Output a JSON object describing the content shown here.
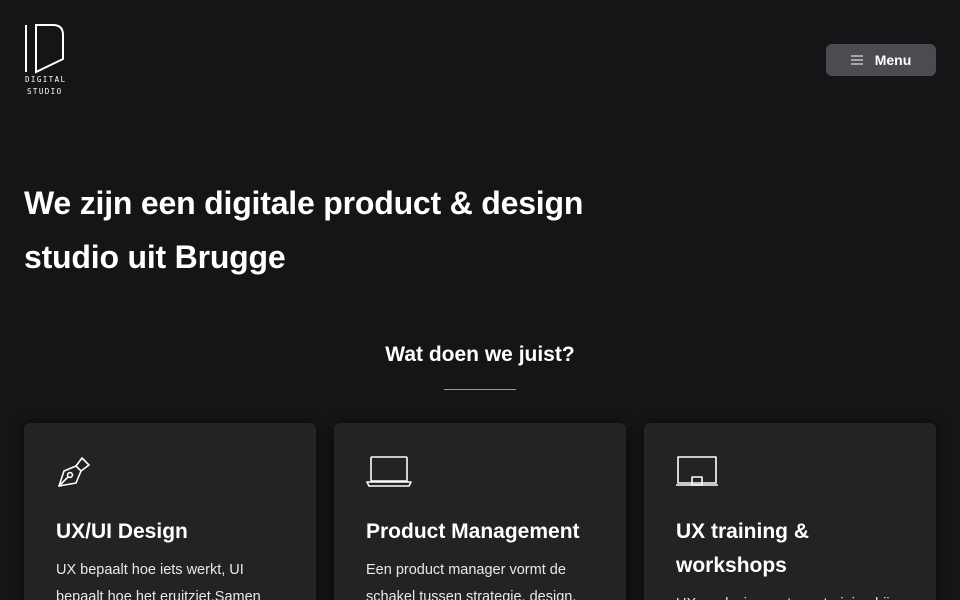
{
  "header": {
    "logo": {
      "line1": "DIGITAL",
      "line2": "STUDIO"
    },
    "menu_label": "Menu"
  },
  "hero": {
    "title": "We zijn een digitale product & design studio uit Brugge"
  },
  "services_section": {
    "title": "Wat doen we juist?",
    "cards": [
      {
        "icon": "pen-nib-icon",
        "title": "UX/UI Design",
        "text": "UX bepaalt hoe iets werkt, UI bepaalt hoe het eruitziet.Samen"
      },
      {
        "icon": "laptop-icon",
        "title": "Product Management",
        "text": "Een product manager vormt de schakel tussen strategie, design,"
      },
      {
        "icon": "whiteboard-icon",
        "title": "UX training & workshops",
        "text": "UX en design met een training bij"
      }
    ]
  },
  "colors": {
    "background": "#151416",
    "card": "#232225",
    "menu_button": "#4c4b50",
    "text": "#ffffff"
  }
}
